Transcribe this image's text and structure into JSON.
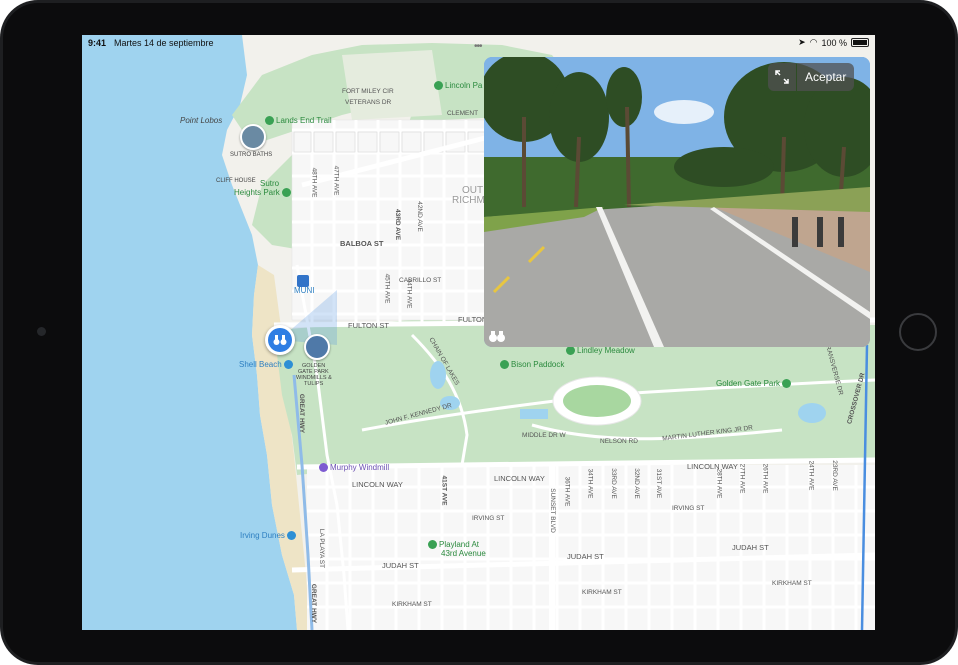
{
  "status_bar": {
    "time": "9:41",
    "date": "Martes 14 de septiembre",
    "battery": "100 %"
  },
  "look_around": {
    "done_label": "Aceptar",
    "expand_icon": "expand-arrows-icon",
    "binoculars_icon": "binoculars-icon"
  },
  "places": {
    "lincoln_park": "Lincoln Pa",
    "lands_end_trail": "Lands End Trail",
    "point_lobos": "Point Lobos",
    "sutro_baths": "SUTRO BATHS",
    "cliff_house": "CLIFF HOUSE",
    "sutro_heights_park_1": "Sutro",
    "sutro_heights_park_2": "Heights Park",
    "muni": "MUNI",
    "golden_gate_windmills_1": "GOLDEN",
    "golden_gate_windmills_2": "GATE PARK",
    "golden_gate_windmills_3": "WINDMILLS &",
    "golden_gate_windmills_4": "TULIPS",
    "shell_beach": "Shell Beach",
    "lindley_meadow": "Lindley Meadow",
    "bison_paddock": "Bison Paddock",
    "golden_gate_park": "Golden Gate Park",
    "murphy_windmill": "Murphy Windmill",
    "irving_dunes": "Irving Dunes",
    "playland_1": "Playland At",
    "playland_2": "43rd Avenue",
    "outer_richmond_1": "OUT",
    "outer_richmond_2": "RICHM",
    "fort_miley_1": "FORT MILEY CIR",
    "fort_miley_2": "VETERANS DR"
  },
  "streets": {
    "clement": "CLEMENT",
    "balboa": "BALBOA ST",
    "cabrillo": "CABRILLO ST",
    "fulton_1": "FULTON ST",
    "fulton_2": "FULTON",
    "lincoln_1": "LINCOLN WAY",
    "lincoln_2": "LINCOLN WAY",
    "lincoln_3": "LINCOLN WAY",
    "judah_1": "JUDAH ST",
    "judah_2": "JUDAH ST",
    "judah_3": "JUDAH ST",
    "kirkham_1": "KIRKHAM ST",
    "kirkham_2": "KIRKHAM ST",
    "kirkham_3": "KIRKHAM ST",
    "irving_1": "IRVING ST",
    "irving_2": "IRVING ST",
    "great_hwy_1": "GREAT HWY",
    "great_hwy_2": "GREAT HWY",
    "la_playa": "LA PLAYA ST",
    "jfk": "JOHN F. KENNEDY DR",
    "chain_of_lakes": "CHAIN OF LAKES",
    "middle": "MIDDLE DR W",
    "mlk": "MARTIN LUTHER KING JR DR",
    "nelson": "NELSON RD",
    "crossover": "CROSSOVER DR",
    "transverse": "TRANSVERSE DR",
    "ave_48": "48TH AVE",
    "ave_47": "47TH AVE",
    "ave_43": "43RD AVE",
    "ave_42": "42ND AVE",
    "ave_41": "41ST AVE",
    "ave_45": "45TH AVE",
    "ave_44": "44TH AVE",
    "ave_36": "36TH AVE",
    "ave_35": "35TH AVE",
    "ave_34": "34TH AVE",
    "ave_33": "33RD AVE",
    "ave_32": "32ND AVE",
    "ave_31": "31ST AVE",
    "ave_28": "28TH AVE",
    "ave_27": "27TH AVE",
    "ave_26": "26TH AVE",
    "ave_25": "25TH AVE",
    "ave_24": "24TH AVE",
    "ave_23": "23RD AVE",
    "sunset": "SUNSET BLVD"
  }
}
